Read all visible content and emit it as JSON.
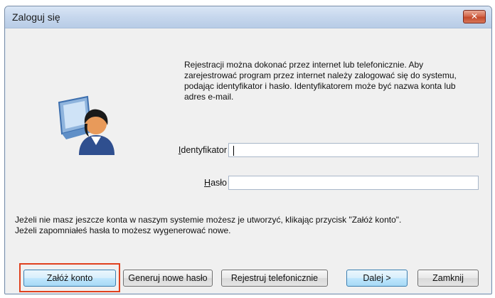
{
  "window": {
    "title": "Zaloguj się",
    "close_label": "✕"
  },
  "info_text": "Rejestracji można dokonać przez internet lub telefonicznie. Aby zarejestrować program przez internet należy zalogować się do systemu, podając identyfikator i hasło. Identyfikatorem może być nazwa konta lub adres e-mail.",
  "fields": {
    "identifier": {
      "label_underlined": "I",
      "label_rest": "dentyfikator",
      "value": ""
    },
    "password": {
      "label_underlined": "H",
      "label_rest": "asło",
      "value": ""
    }
  },
  "note_text": "Jeżeli nie masz jeszcze konta w naszym systemie możesz je utworzyć, klikając przycisk \"Załóż konto\". Jeżeli zapomniałeś hasła to możesz wygenerować nowe.",
  "buttons": {
    "create_account": "Załóż konto",
    "generate_password": "Generuj nowe hasło",
    "register_phone": "Rejestruj telefonicznie",
    "next": "Dalej >",
    "close": "Zamknij"
  },
  "colors": {
    "highlight": "#e0401e",
    "default_button": "#3c7fb1"
  },
  "icons": {
    "user": "user-computer-icon",
    "close": "close-icon"
  }
}
